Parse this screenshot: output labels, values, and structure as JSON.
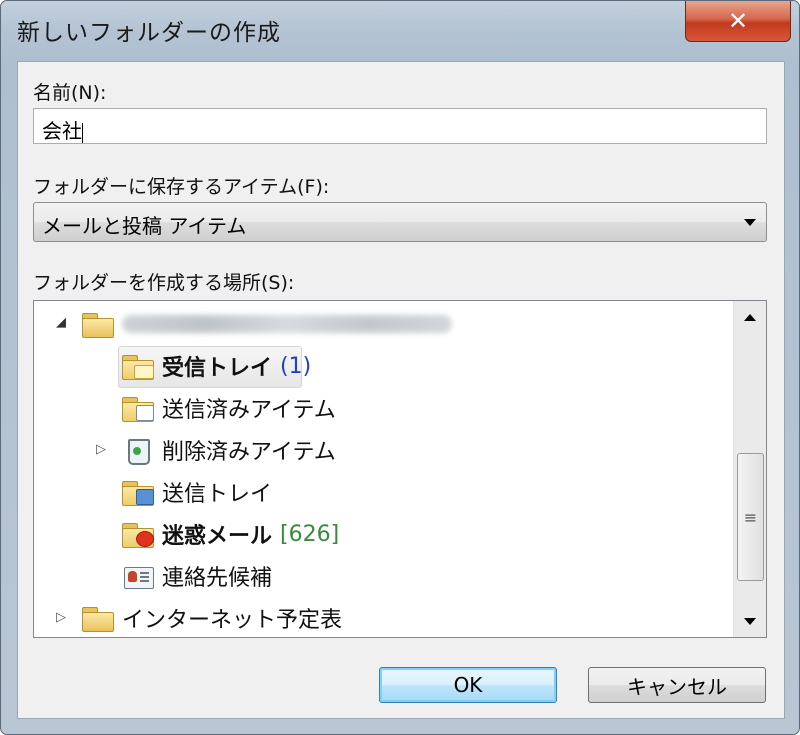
{
  "window": {
    "title": "新しいフォルダーの作成",
    "close_glyph": "✕"
  },
  "name_field": {
    "label": "名前(N):",
    "value": "会社"
  },
  "contains_select": {
    "label": "フォルダーに保存するアイテム(F):",
    "selected": "メールと投稿 アイテム"
  },
  "location": {
    "label": "フォルダーを作成する場所(S):",
    "tree": [
      {
        "label": "",
        "icon": "account-folder-icon",
        "expanded": true,
        "blurred": true
      },
      {
        "label": "受信トレイ",
        "count": "(1)",
        "icon": "inbox-folder-icon",
        "bold": true,
        "selected": true
      },
      {
        "label": "送信済みアイテム",
        "icon": "sent-items-folder-icon"
      },
      {
        "label": "削除済みアイテム",
        "icon": "deleted-items-icon",
        "expandable": true
      },
      {
        "label": "送信トレイ",
        "icon": "outbox-folder-icon"
      },
      {
        "label": "迷惑メール",
        "count": "[626]",
        "icon": "junk-mail-folder-icon",
        "bold": true
      },
      {
        "label": "連絡先候補",
        "icon": "contacts-icon"
      },
      {
        "label": "インターネット予定表",
        "icon": "calendar-folder-icon",
        "expandable": true
      }
    ]
  },
  "buttons": {
    "ok": "OK",
    "cancel": "キャンセル"
  }
}
